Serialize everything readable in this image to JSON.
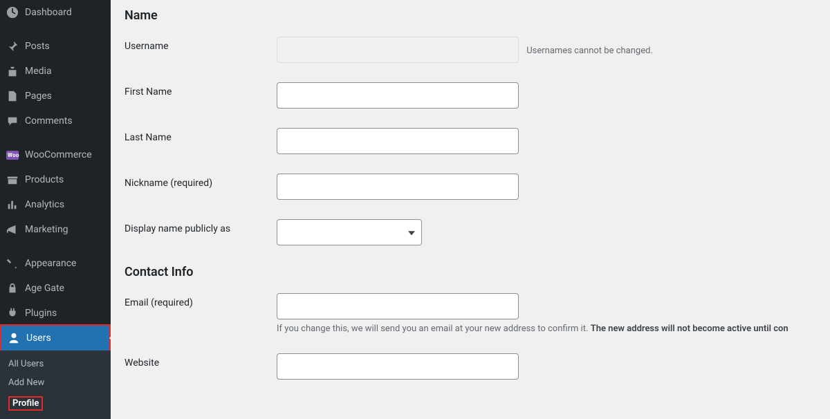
{
  "sidebar": {
    "items": {
      "dashboard": "Dashboard",
      "posts": "Posts",
      "media": "Media",
      "pages": "Pages",
      "comments": "Comments",
      "woocommerce": "WooCommerce",
      "products": "Products",
      "analytics": "Analytics",
      "marketing": "Marketing",
      "appearance": "Appearance",
      "age_gate": "Age Gate",
      "plugins": "Plugins",
      "users": "Users"
    },
    "submenu": {
      "all_users": "All Users",
      "add_new": "Add New",
      "profile": "Profile"
    },
    "woo_badge": "Woo"
  },
  "content": {
    "section_name": "Name",
    "section_contact": "Contact Info",
    "fields": {
      "username_label": "Username",
      "username_hint": "Usernames cannot be changed.",
      "first_name_label": "First Name",
      "last_name_label": "Last Name",
      "nickname_label": "Nickname",
      "nickname_req": "(required)",
      "display_label": "Display name publicly as",
      "email_label": "Email",
      "email_req": "(required)",
      "email_desc_a": "If you change this, we will send you an email at your new address to confirm it. ",
      "email_desc_b": "The new address will not become active until con",
      "website_label": "Website"
    }
  }
}
